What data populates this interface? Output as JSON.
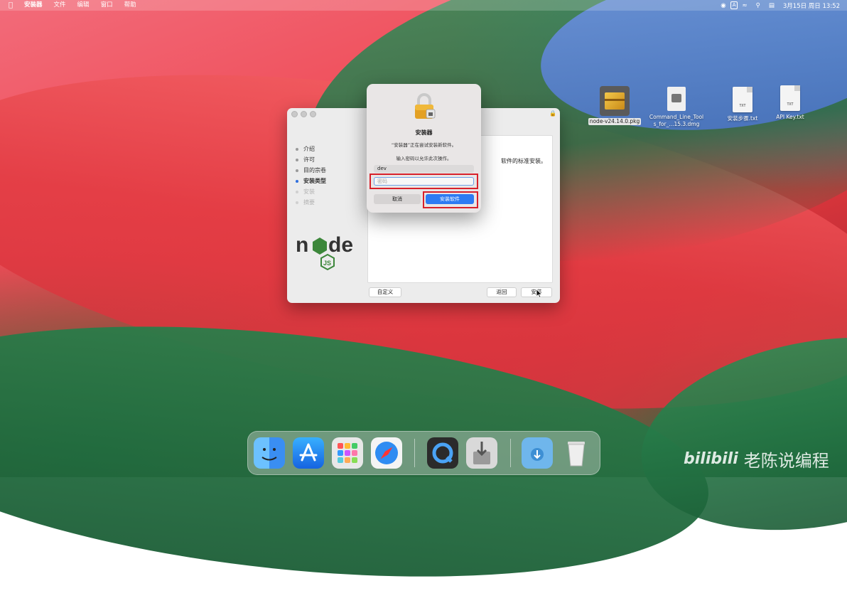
{
  "menubar": {
    "app_name": "安装器",
    "menus": [
      "文件",
      "编辑",
      "窗口",
      "帮助"
    ],
    "input_method": "A",
    "datetime": "3月15日 周日  13:52"
  },
  "desktop_icons": [
    {
      "label": "node-v24.14.0.pkg",
      "icon": "package-icon",
      "selected": true
    },
    {
      "label": "Command_Line_Tools_for_...15.3.dmg",
      "icon": "disk-image-icon",
      "selected": false
    },
    {
      "label": "安装步骤.txt",
      "badge": "TXT",
      "icon": "text-file-icon",
      "selected": false
    },
    {
      "label": "API Key.txt",
      "badge": "TXT",
      "icon": "text-file-icon",
      "selected": false
    }
  ],
  "installer": {
    "steps": [
      {
        "label": "介绍",
        "state": "done"
      },
      {
        "label": "许可",
        "state": "done"
      },
      {
        "label": "目的宗卷",
        "state": "done"
      },
      {
        "label": "安装类型",
        "state": "active"
      },
      {
        "label": "安装",
        "state": "pending"
      },
      {
        "label": "摘要",
        "state": "pending"
      }
    ],
    "content_text": "软件的标准安装。",
    "customize_label": "自定义",
    "back_label": "返回",
    "install_label": "安装"
  },
  "auth_dialog": {
    "title": "安装器",
    "message": "“安装器”正在尝试安装新软件。",
    "hint": "输入密码以允许此次操作。",
    "username": "dev",
    "password_placeholder": "密码",
    "cancel_label": "取消",
    "confirm_label": "安装软件"
  },
  "dock": {
    "apps": [
      "finder-icon",
      "app-store-icon",
      "launchpad-icon",
      "safari-icon",
      "quicktime-icon",
      "installer-icon",
      "downloads-folder-icon",
      "trash-icon"
    ]
  },
  "watermark": {
    "brand": "bilibili",
    "author": "老陈说编程"
  },
  "colors": {
    "accent_blue": "#2d7bf3",
    "highlight_red": "#d8202a"
  }
}
